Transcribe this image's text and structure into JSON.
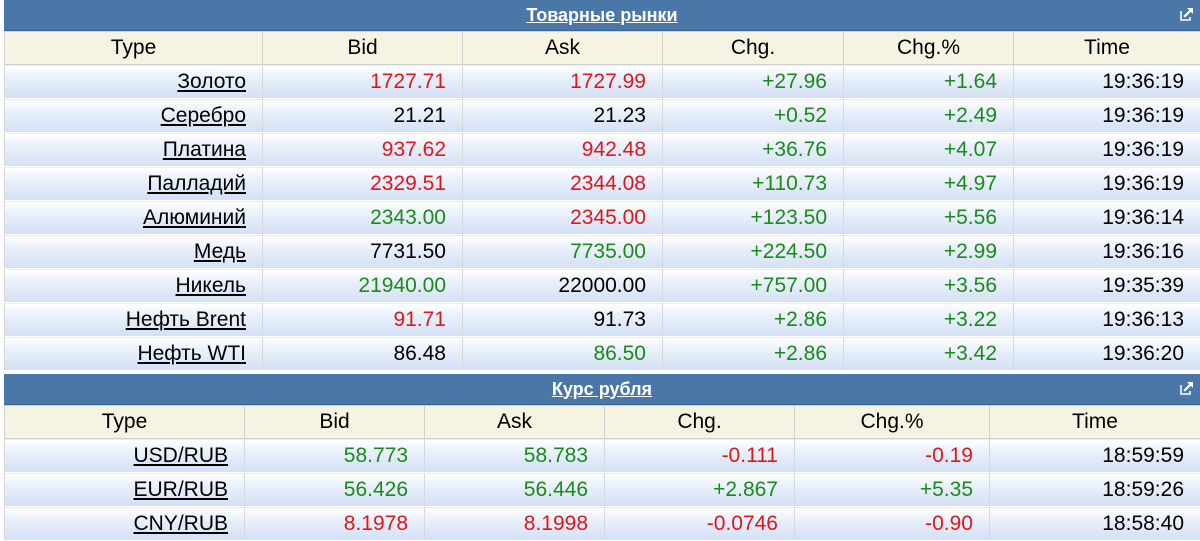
{
  "colors": {
    "red": "#e0161b",
    "green": "#1a8a1a",
    "black": "#000000",
    "titlebar": "#4b77a8"
  },
  "icons": {
    "external": "external-link-icon"
  },
  "commodities": {
    "title": "Товарные рынки",
    "columns": [
      "Type",
      "Bid",
      "Ask",
      "Chg.",
      "Chg.%",
      "Time"
    ],
    "rows": [
      {
        "type": "Золото",
        "bid": "1727.71",
        "bid_color": "red",
        "ask": "1727.99",
        "ask_color": "red",
        "chg": "+27.96",
        "chg_pct": "+1.64",
        "time": "19:36:19"
      },
      {
        "type": "Серебро",
        "bid": "21.21",
        "bid_color": "black",
        "ask": "21.23",
        "ask_color": "black",
        "chg": "+0.52",
        "chg_pct": "+2.49",
        "time": "19:36:19"
      },
      {
        "type": "Платина",
        "bid": "937.62",
        "bid_color": "red",
        "ask": "942.48",
        "ask_color": "red",
        "chg": "+36.76",
        "chg_pct": "+4.07",
        "time": "19:36:19"
      },
      {
        "type": "Палладий",
        "bid": "2329.51",
        "bid_color": "red",
        "ask": "2344.08",
        "ask_color": "red",
        "chg": "+110.73",
        "chg_pct": "+4.97",
        "time": "19:36:19"
      },
      {
        "type": "Алюминий",
        "bid": "2343.00",
        "bid_color": "green",
        "ask": "2345.00",
        "ask_color": "red",
        "chg": "+123.50",
        "chg_pct": "+5.56",
        "time": "19:36:14"
      },
      {
        "type": "Медь",
        "bid": "7731.50",
        "bid_color": "black",
        "ask": "7735.00",
        "ask_color": "green",
        "chg": "+224.50",
        "chg_pct": "+2.99",
        "time": "19:36:16"
      },
      {
        "type": "Никель",
        "bid": "21940.00",
        "bid_color": "green",
        "ask": "22000.00",
        "ask_color": "black",
        "chg": "+757.00",
        "chg_pct": "+3.56",
        "time": "19:35:39"
      },
      {
        "type": "Нефть Brent",
        "bid": "91.71",
        "bid_color": "red",
        "ask": "91.73",
        "ask_color": "black",
        "chg": "+2.86",
        "chg_pct": "+3.22",
        "time": "19:36:13"
      },
      {
        "type": "Нефть WTI",
        "bid": "86.48",
        "bid_color": "black",
        "ask": "86.50",
        "ask_color": "green",
        "chg": "+2.86",
        "chg_pct": "+3.42",
        "time": "19:36:20"
      }
    ]
  },
  "rub": {
    "title": "Курс рубля",
    "columns": [
      "Type",
      "Bid",
      "Ask",
      "Chg.",
      "Chg.%",
      "Time"
    ],
    "rows": [
      {
        "type": "USD/RUB",
        "bid": "58.773",
        "bid_color": "green",
        "ask": "58.783",
        "ask_color": "green",
        "chg": "-0.111",
        "chg_color": "red",
        "chg_pct": "-0.19",
        "chg_pct_color": "red",
        "time": "18:59:59"
      },
      {
        "type": "EUR/RUB",
        "bid": "56.426",
        "bid_color": "green",
        "ask": "56.446",
        "ask_color": "green",
        "chg": "+2.867",
        "chg_color": "green",
        "chg_pct": "+5.35",
        "chg_pct_color": "green",
        "time": "18:59:26"
      },
      {
        "type": "CNY/RUB",
        "bid": "8.1978",
        "bid_color": "red",
        "ask": "8.1998",
        "ask_color": "red",
        "chg": "-0.0746",
        "chg_color": "red",
        "chg_pct": "-0.90",
        "chg_pct_color": "red",
        "time": "18:58:40"
      }
    ]
  }
}
